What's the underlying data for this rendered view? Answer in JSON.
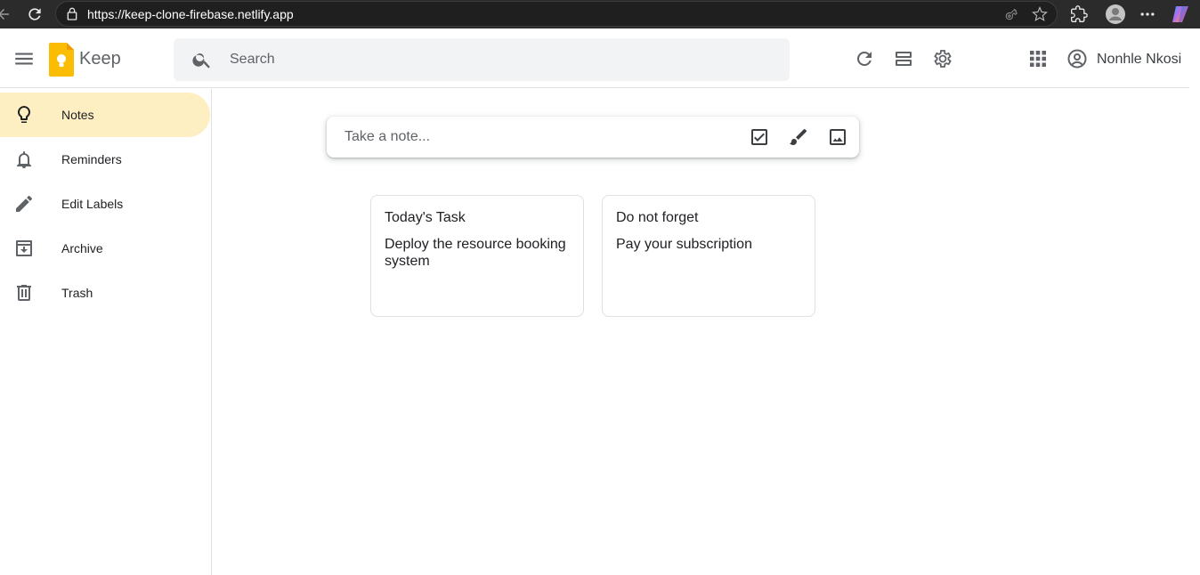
{
  "browser": {
    "url": "https://keep-clone-firebase.netlify.app"
  },
  "header": {
    "app_name": "Keep",
    "search_placeholder": "Search",
    "user_name": "Nonhle Nkosi"
  },
  "sidebar": {
    "items": [
      {
        "label": "Notes",
        "icon": "lightbulb-icon",
        "active": true
      },
      {
        "label": "Reminders",
        "icon": "bell-icon",
        "active": false
      },
      {
        "label": "Edit Labels",
        "icon": "pencil-icon",
        "active": false
      },
      {
        "label": "Archive",
        "icon": "archive-icon",
        "active": false
      },
      {
        "label": "Trash",
        "icon": "trash-icon",
        "active": false
      }
    ]
  },
  "take_note": {
    "placeholder": "Take a note..."
  },
  "notes": [
    {
      "title": "Today's Task",
      "body": "Deploy the resource booking system"
    },
    {
      "title": "Do not forget",
      "body": "Pay your subscription"
    }
  ],
  "colors": {
    "active_nav": "#feefc3",
    "logo_yellow": "#fbbc04",
    "icon_gray": "#5f6368"
  }
}
